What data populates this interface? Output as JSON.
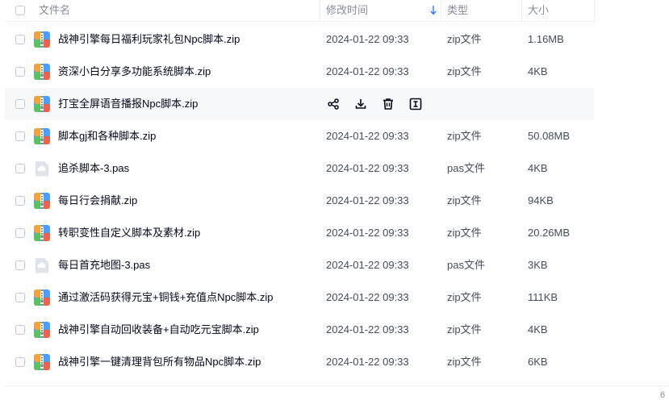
{
  "header": {
    "name": "文件名",
    "time": "修改时间",
    "type": "类型",
    "size": "大小"
  },
  "colors": {
    "zip_blue": "#4d9ff8",
    "zip_orange": "#f8a235",
    "zip_green": "#58c45e",
    "zip_red": "#f0604a",
    "pas_gray": "#dfe3ea",
    "sort_arrow": "#2f7cf6",
    "hover_row": "#f7f8fa"
  },
  "actions": [
    "share-icon",
    "download-icon",
    "delete-icon",
    "more-icon"
  ],
  "files": [
    {
      "name": "战神引擎每日福利玩家礼包Npc脚本.zip",
      "time": "2024-01-22 09:33",
      "type": "zip文件",
      "size": "1.16MB",
      "icon": "zip-file-icon"
    },
    {
      "name": "资深小白分享多功能系统脚本.zip",
      "time": "2024-01-22 09:33",
      "type": "zip文件",
      "size": "4KB",
      "icon": "zip-file-icon"
    },
    {
      "name": "打宝全屏语音播报Npc脚本.zip",
      "time": "",
      "type": "",
      "size": "",
      "icon": "zip-file-icon",
      "hover": true
    },
    {
      "name": "脚本gj和各种脚本.zip",
      "time": "2024-01-22 09:33",
      "type": "zip文件",
      "size": "50.08MB",
      "icon": "zip-file-icon"
    },
    {
      "name": "追杀脚本-3.pas",
      "time": "2024-01-22 09:33",
      "type": "pas文件",
      "size": "4KB",
      "icon": "cloud-file-icon"
    },
    {
      "name": "每日行会捐献.zip",
      "time": "2024-01-22 09:33",
      "type": "zip文件",
      "size": "94KB",
      "icon": "zip-file-icon"
    },
    {
      "name": "转职变性自定义脚本及素材.zip",
      "time": "2024-01-22 09:33",
      "type": "zip文件",
      "size": "20.26MB",
      "icon": "zip-file-icon"
    },
    {
      "name": "每日首充地图-3.pas",
      "time": "2024-01-22 09:33",
      "type": "pas文件",
      "size": "3KB",
      "icon": "cloud-file-icon"
    },
    {
      "name": "通过激活码获得元宝+铜钱+充值点Npc脚本.zip",
      "time": "2024-01-22 09:33",
      "type": "zip文件",
      "size": "111KB",
      "icon": "zip-file-icon"
    },
    {
      "name": "战神引擎自动回收装备+自动吃元宝脚本.zip",
      "time": "2024-01-22 09:33",
      "type": "zip文件",
      "size": "4KB",
      "icon": "zip-file-icon"
    },
    {
      "name": "战神引擎一键清理背包所有物品Npc脚本.zip",
      "time": "2024-01-22 09:33",
      "type": "zip文件",
      "size": "6KB",
      "icon": "zip-file-icon"
    }
  ],
  "footer": {
    "partial_text": "6"
  }
}
